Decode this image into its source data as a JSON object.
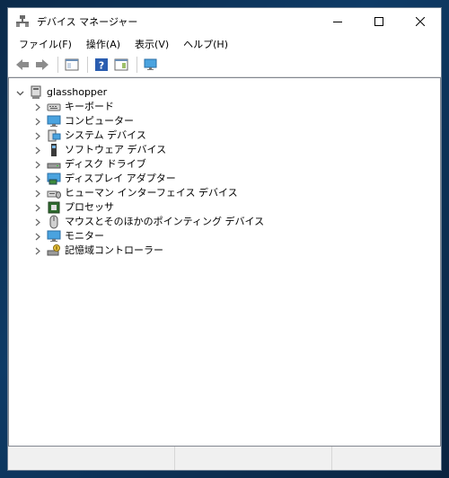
{
  "window": {
    "title": "デバイス マネージャー",
    "caption": {
      "minimize": "minimize",
      "maximize": "maximize",
      "close": "close"
    }
  },
  "menu": {
    "items": [
      {
        "label": "ファイル(F)"
      },
      {
        "label": "操作(A)"
      },
      {
        "label": "表示(V)"
      },
      {
        "label": "ヘルプ(H)"
      }
    ]
  },
  "toolbar": {
    "buttons": [
      "back-icon",
      "forward-icon",
      "properties-view-icon",
      "help-icon",
      "action-pane-icon",
      "monitor-scan-icon"
    ]
  },
  "tree": {
    "root": {
      "label": "glasshopper",
      "icon": "computer-icon"
    },
    "items": [
      {
        "label": "キーボード",
        "icon": "keyboard-icon"
      },
      {
        "label": "コンピューター",
        "icon": "computer-icon"
      },
      {
        "label": "システム デバイス",
        "icon": "system-device-icon"
      },
      {
        "label": "ソフトウェア デバイス",
        "icon": "software-device-icon"
      },
      {
        "label": "ディスク ドライブ",
        "icon": "disk-drive-icon"
      },
      {
        "label": "ディスプレイ アダプター",
        "icon": "display-adapter-icon"
      },
      {
        "label": "ヒューマン インターフェイス デバイス",
        "icon": "hid-icon"
      },
      {
        "label": "プロセッサ",
        "icon": "processor-icon"
      },
      {
        "label": "マウスとそのほかのポインティング デバイス",
        "icon": "mouse-icon"
      },
      {
        "label": "モニター",
        "icon": "monitor-icon"
      },
      {
        "label": "記憶域コントローラー",
        "icon": "storage-controller-icon"
      }
    ]
  }
}
